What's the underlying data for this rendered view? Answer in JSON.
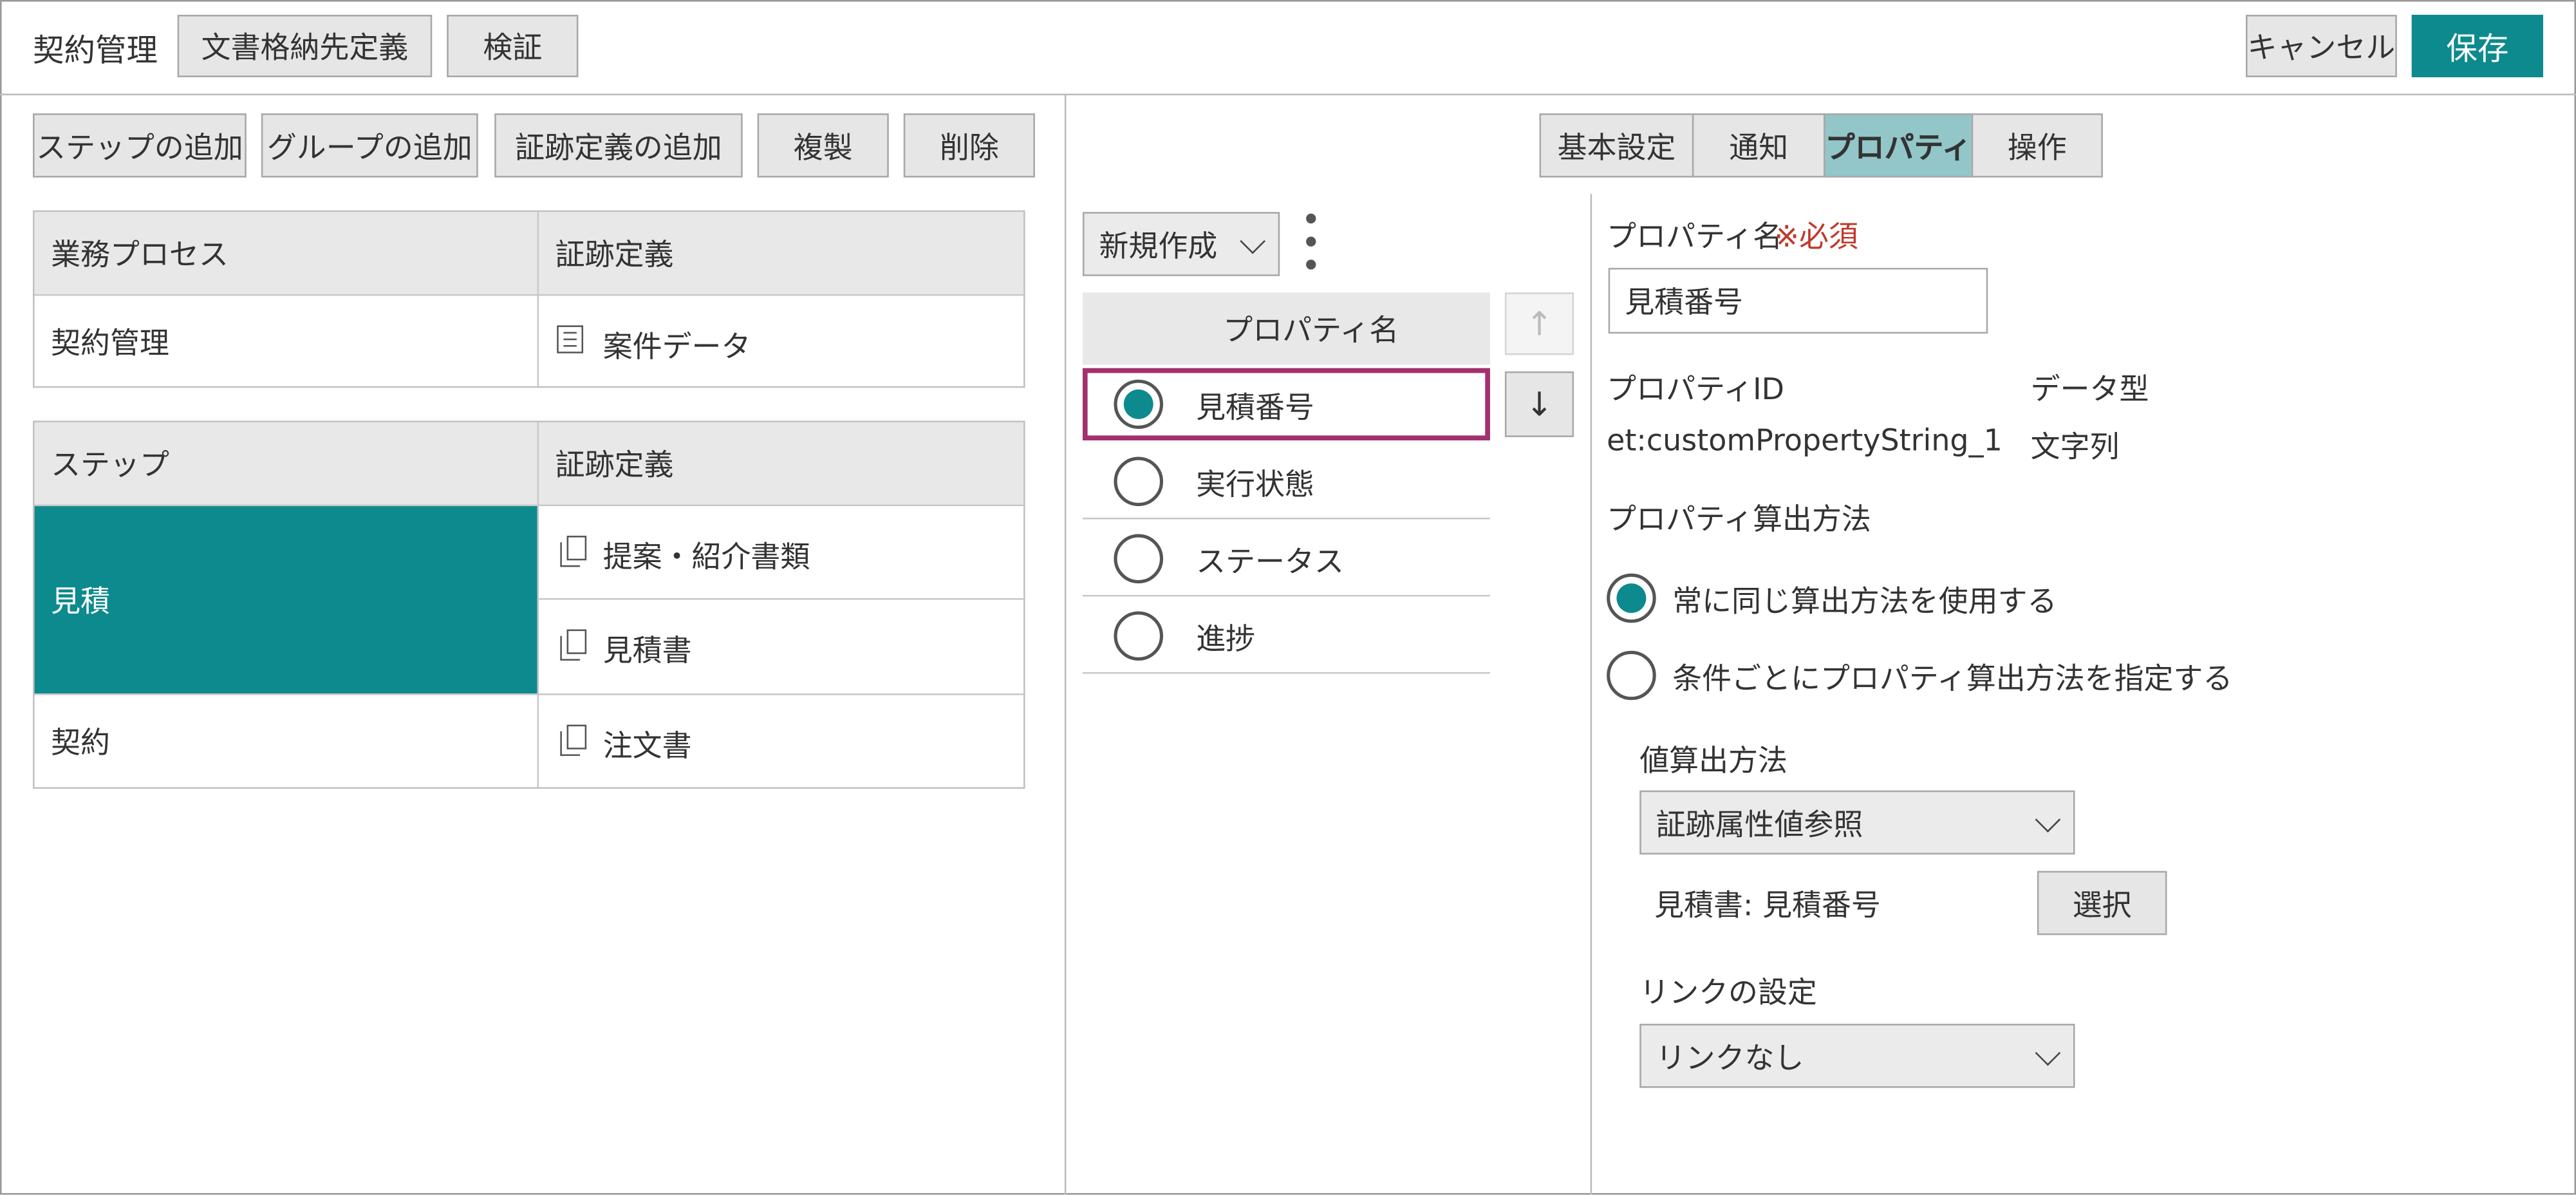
{
  "header": {
    "title": "契約管理",
    "tab_storage": "文書格納先定義",
    "verify_button": "検証",
    "cancel_button": "キャンセル",
    "save_button": "保存"
  },
  "toolbar": {
    "add_step": "ステップの追加",
    "add_group": "グループの追加",
    "add_evidence": "証跡定義の追加",
    "duplicate": "複製",
    "delete": "削除"
  },
  "process_table": {
    "headers": [
      "業務プロセス",
      "証跡定義"
    ],
    "row": {
      "process": "契約管理",
      "evidence": "案件データ",
      "icon": "list-document-icon"
    }
  },
  "step_table": {
    "headers": [
      "ステップ",
      "証跡定義"
    ],
    "steps": [
      {
        "name": "見積",
        "selected": true,
        "evidence": [
          "提案・紹介書類",
          "見積書"
        ]
      },
      {
        "name": "契約",
        "selected": false,
        "evidence": [
          "注文書"
        ]
      }
    ],
    "icon": "document-copy-icon"
  },
  "right_tabs": {
    "items": [
      "基本設定",
      "通知",
      "プロパティ",
      "操作"
    ],
    "active": "プロパティ"
  },
  "property_list": {
    "new_button": "新規作成",
    "more_icon": "vertical-ellipsis-icon",
    "header": "プロパティ名",
    "up_icon": "arrow-up-icon",
    "down_icon": "arrow-down-icon",
    "items": [
      {
        "label": "見積番号",
        "selected": true
      },
      {
        "label": "実行状態",
        "selected": false
      },
      {
        "label": "ステータス",
        "selected": false
      },
      {
        "label": "進捗",
        "selected": false
      }
    ]
  },
  "property_detail": {
    "name_label": "プロパティ名",
    "required_mark": "※必須",
    "name_value": "見積番号",
    "id_label": "プロパティID",
    "id_value": "et:customPropertyString_1",
    "type_label": "データ型",
    "type_value": "文字列",
    "calc_label": "プロパティ算出方法",
    "calc_options": [
      {
        "label": "常に同じ算出方法を使用する",
        "selected": true
      },
      {
        "label": "条件ごとにプロパティ算出方法を指定する",
        "selected": false
      }
    ],
    "value_method_label": "値算出方法",
    "value_method_selected": "証跡属性値参照",
    "reference_value": "見積書: 見積番号",
    "select_button": "選択",
    "link_label": "リンクの設定",
    "link_selected": "リンクなし"
  },
  "colors": {
    "accent": "#0d8a8e",
    "active_tab": "#92c6c8",
    "highlight_border": "#a3316d",
    "required": "#c0392b"
  }
}
